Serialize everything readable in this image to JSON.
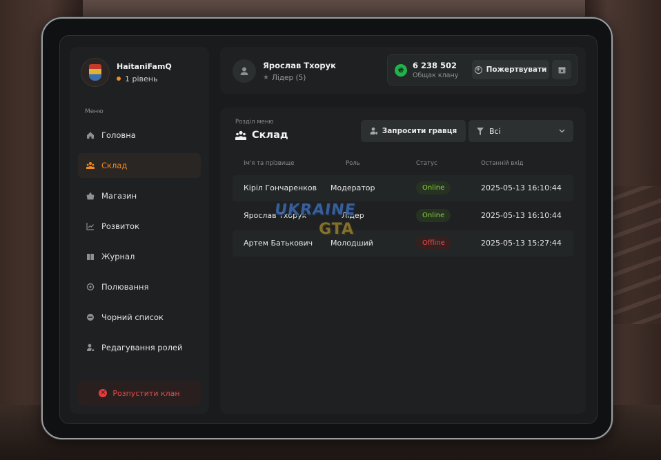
{
  "clan": {
    "name": "HaitaniFamQ",
    "level": "1 рівень"
  },
  "sidebar": {
    "menu_label": "Меню",
    "items": [
      {
        "label": "Головна",
        "icon": "home-icon"
      },
      {
        "label": "Склад",
        "icon": "people-icon",
        "active": true
      },
      {
        "label": "Магазин",
        "icon": "basket-icon"
      },
      {
        "label": "Розвиток",
        "icon": "chart-icon"
      },
      {
        "label": "Журнал",
        "icon": "book-icon"
      },
      {
        "label": "Полювання",
        "icon": "target-icon"
      },
      {
        "label": "Чорний список",
        "icon": "minus-circle-icon"
      },
      {
        "label": "Редагування ролей",
        "icon": "user-edit-icon"
      }
    ],
    "disband_label": "Розпустити клан"
  },
  "leader": {
    "name": "Ярослав Тхорук",
    "role": "Лідер (5)"
  },
  "bank": {
    "currency_symbol": "₴",
    "value": "6 238 502",
    "label": "Общак клану",
    "donate_label": "Пожертвувати"
  },
  "section": {
    "subtitle": "Розділ меню",
    "title": "Склад",
    "invite_label": "Запросити гравця",
    "filter_value": "Всі"
  },
  "table": {
    "headers": [
      "Ім'я та прізвище",
      "Роль",
      "Статус",
      "Останній вхід"
    ],
    "rows": [
      {
        "name": "Кіріл Гончаренков",
        "role": "Модератор",
        "status": "Online",
        "last_login": "2025-05-13 16:10:44"
      },
      {
        "name": "Ярослав Тхорук",
        "role": "Лідер",
        "status": "Online",
        "last_login": "2025-05-13 16:10:44"
      },
      {
        "name": "Артем Батькович",
        "role": "Молодший",
        "status": "Offline",
        "last_login": "2025-05-13 15:27:44"
      }
    ]
  },
  "watermark": {
    "line1": "UKRAINE",
    "line2": "GTA"
  },
  "colors": {
    "accent": "#f08a24",
    "online": "#8ccf3f",
    "offline": "#ea4b4b",
    "coin": "#22b24c"
  }
}
